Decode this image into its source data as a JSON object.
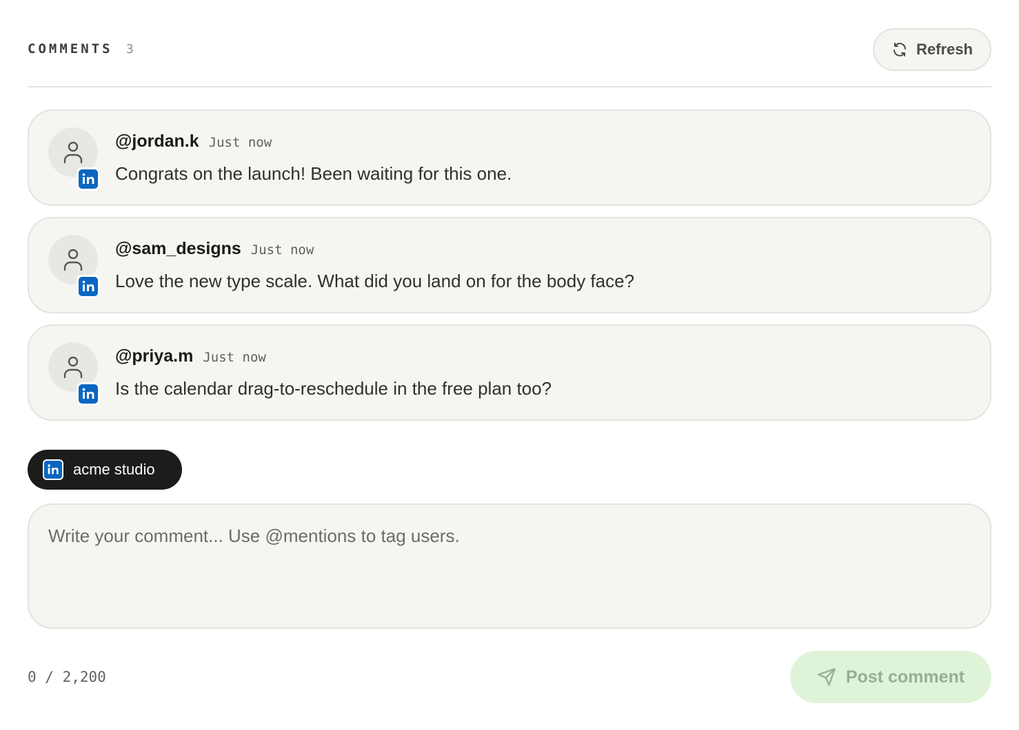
{
  "header": {
    "title": "COMMENTS",
    "count": "3",
    "refresh_label": "Refresh"
  },
  "comments": [
    {
      "user": "@jordan.k",
      "time": "Just now",
      "text": "Congrats on the launch! Been waiting for this one.",
      "platform_icon": "linkedin-icon"
    },
    {
      "user": "@sam_designs",
      "time": "Just now",
      "text": "Love the new type scale. What did you land on for the body face?",
      "platform_icon": "linkedin-icon"
    },
    {
      "user": "@priya.m",
      "time": "Just now",
      "text": "Is the calendar drag-to-reschedule in the free plan too?",
      "platform_icon": "linkedin-icon"
    }
  ],
  "identity": {
    "name": "acme studio",
    "platform_icon": "linkedin-icon"
  },
  "composer": {
    "value": "",
    "placeholder": "Write your comment... Use @mentions to tag users."
  },
  "footer": {
    "char_count": "0 / 2,200",
    "post_label": "Post comment"
  },
  "colors": {
    "linkedin": "#0a66c2",
    "post_button_bg": "#dff3d9",
    "chip_bg": "#1c1c1b",
    "card_bg": "#f5f5f1"
  }
}
